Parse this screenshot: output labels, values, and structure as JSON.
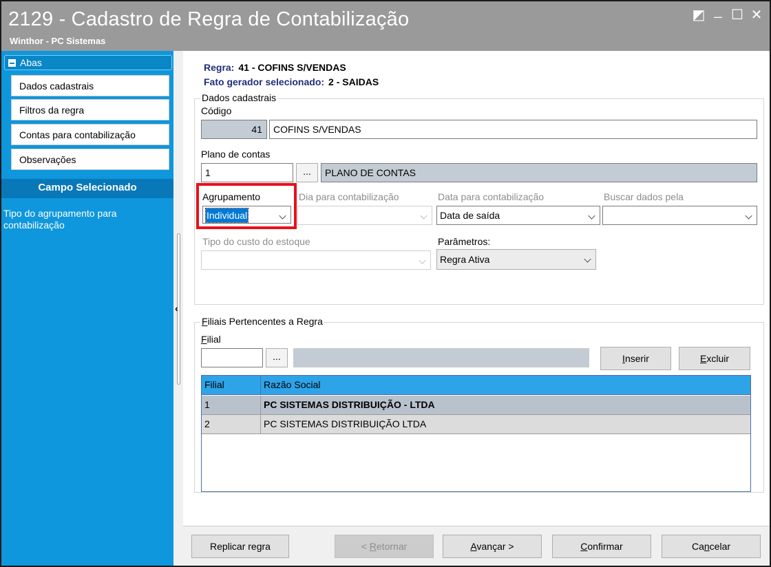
{
  "window": {
    "title": "2129 - Cadastro de Regra de Contabilização",
    "subtitle": "Winthor - PC Sistemas",
    "controls": {
      "restore": "◩",
      "minimize": "_",
      "maximize": "☐",
      "close": "✕"
    }
  },
  "sidebar": {
    "abas_label": "Abas",
    "items": [
      {
        "label": "Dados cadastrais"
      },
      {
        "label": "Filtros da regra"
      },
      {
        "label": "Contas para contabilização"
      },
      {
        "label": "Observações"
      }
    ],
    "campo_header": "Campo Selecionado",
    "campo_desc": "Tipo do agrupamento para contabilização"
  },
  "header": {
    "regra_label": "Regra:",
    "regra_value": "41 - COFINS S/VENDAS",
    "fato_label": "Fato gerador selecionado:",
    "fato_value": "2 - SAIDAS"
  },
  "dados": {
    "legend": "Dados cadastrais",
    "codigo_label": "Código",
    "codigo_value": "41",
    "descricao_value": "COFINS S/VENDAS",
    "plano_label": "Plano de contas",
    "plano_code": "1",
    "plano_dots": "...",
    "plano_desc": "PLANO DE CONTAS",
    "agrupamento_label": "Agrupamento",
    "agrupamento_value": "Individual",
    "dia_label": "Dia para contabilização",
    "dia_value": "",
    "data_label": "Data para contabilização",
    "data_value": "Data de saída",
    "buscar_label": "Buscar dados pela",
    "buscar_value": "",
    "tipo_custo_label": "Tipo do custo do estoque",
    "tipo_custo_value": "",
    "parametros_label": "Parâmetros:",
    "parametros_value": "Regra Ativa"
  },
  "filiais": {
    "legend": "Filiais Pertencentes a Regra",
    "filial_label": "Filial",
    "filial_value": "",
    "dots": "...",
    "desc_value": "",
    "inserir": "Inserir",
    "excluir": "Excluir",
    "columns": [
      "Filial",
      "Razão Social"
    ],
    "rows": [
      {
        "filial": "1",
        "razao": "PC SISTEMAS DISTRIBUIÇÃO - LTDA"
      },
      {
        "filial": "2",
        "razao": "PC SISTEMAS DISTRIBUIÇÃO LTDA"
      }
    ]
  },
  "buttons": {
    "replicar": "Replicar regra",
    "retornar": "< Retornar",
    "avancar": "Avançar >",
    "confirmar": "Confirmar",
    "cancelar": "Cancelar"
  },
  "colors": {
    "sidebar_bg": "#0e97dc",
    "campo_header_bg": "#0878b8",
    "titlebar_bg": "#9a9a9a",
    "highlight": "#e8101c",
    "grid_header": "#2ea3e8",
    "info_text": "#1f2f7a"
  }
}
